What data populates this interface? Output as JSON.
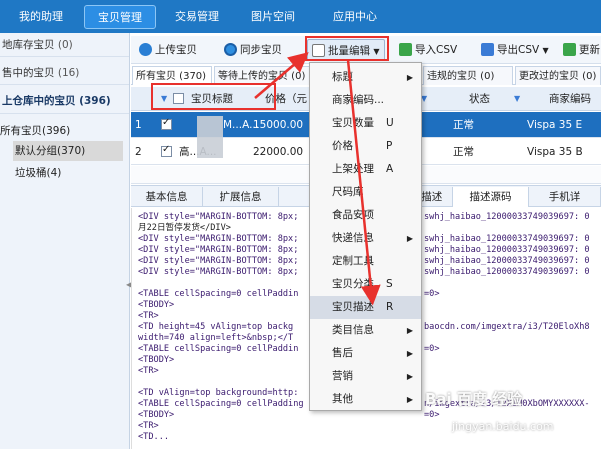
{
  "topnav": {
    "tabs": [
      "我的助理",
      "宝贝管理",
      "交易管理",
      "图片空间",
      "应用中心"
    ],
    "active": "宝贝管理"
  },
  "sidebar": {
    "groups": [
      {
        "label": "地库存宝贝",
        "count": "(0)"
      },
      {
        "label": "售中的宝贝",
        "count": "(16)"
      },
      {
        "label": "上仓库中的宝贝",
        "count": "(396)"
      }
    ],
    "tree": {
      "root": "所有宝贝(396)",
      "children": [
        "默认分组(370)",
        "垃圾桶(4)"
      ]
    }
  },
  "toolbar": {
    "upload": "上传宝贝",
    "sync": "同步宝贝",
    "batch": "批量编辑",
    "import": "导入CSV",
    "export": "导出CSV",
    "update": "更新"
  },
  "filtertabs": [
    "所有宝贝 (370)",
    "等待上传的宝贝 (0)",
    "",
    "",
    "违规的宝贝 (0)",
    "更改过的宝贝 (0)"
  ],
  "table": {
    "headers": [
      "宝贝标题",
      "价格（元",
      "状态",
      "商家编码"
    ],
    "rows": [
      {
        "num": "1",
        "title": "M...A...",
        "price": "15000.00",
        "status": "正常",
        "code": "Vispa 35 E"
      },
      {
        "num": "2",
        "title": "高...A...",
        "price": "22000.00",
        "status": "正常",
        "code": "Vispa 35 B"
      }
    ]
  },
  "bottabs": [
    "基本信息",
    "扩展信息",
    "",
    "",
    "贝描述",
    "描述源码",
    "手机详"
  ],
  "code": {
    "lines": [
      "<DIV style=\"MARGIN-BOTTOM: 8px;",
      "月22日暂停发货</DIV>",
      "<DIV style=\"MARGIN-BOTTOM: 8px;",
      "<DIV style=\"MARGIN-BOTTOM: 8px;",
      "<DIV style=\"MARGIN-BOTTOM: 8px;",
      "<DIV style=\"MARGIN-BOTTOM: 8px;",
      "<TABLE cellSpacing=0 cellPaddin",
      "<TBODY>",
      "<TR>",
      "<TD height=45 vAlign=top backg",
      "width=740 align=left>&nbsp;</T",
      "<TABLE cellSpacing=0 cellPaddin",
      "<TBODY>",
      "<TR>",
      "<TD vAlign=top background=http:",
      "<TABLE cellSpacing=0 cellPadding",
      "<TBODY>",
      "<TR>",
      "<TD..."
    ],
    "right_lines": [
      "swhj_haibao_12000033749039697: 0",
      "swhj_haibao_12000033749039697: 0",
      "swhj_haibao_12000033749039697: 0",
      "swhj_haibao_12000033749039697: 0",
      "swhj_haibao_12000033749039697: 0",
      "=0>",
      "baocdn.com/imgextra/i3/T20EloXh8",
      "=0>",
      "n/imgextra/i3/T2XIM0XbOMYXXXXXX-",
      "=0>"
    ]
  },
  "menu": {
    "items": [
      {
        "label": "标题",
        "shortcut": "",
        "submenu": true
      },
      {
        "label": "商家编码...",
        "shortcut": "",
        "submenu": false
      },
      {
        "label": "宝贝数量",
        "shortcut": "U",
        "submenu": false
      },
      {
        "label": "价格",
        "shortcut": "P",
        "submenu": false
      },
      {
        "label": "上架处理",
        "shortcut": "A",
        "submenu": false
      },
      {
        "label": "尺码库",
        "shortcut": "",
        "submenu": false
      },
      {
        "label": "食品安项",
        "shortcut": "",
        "submenu": false
      },
      {
        "label": "快递信息",
        "shortcut": "",
        "submenu": true
      },
      {
        "label": "定制工具",
        "shortcut": "",
        "submenu": false
      },
      {
        "label": "宝贝分类",
        "shortcut": "S",
        "submenu": false
      },
      {
        "label": "宝贝描述",
        "shortcut": "R",
        "submenu": false
      },
      {
        "label": "类目信息",
        "shortcut": "",
        "submenu": true
      },
      {
        "label": "售后",
        "shortcut": "",
        "submenu": true
      },
      {
        "label": "营销",
        "shortcut": "",
        "submenu": true
      },
      {
        "label": "其他",
        "shortcut": "",
        "submenu": true
      }
    ],
    "highlighted": "宝贝描述"
  },
  "watermark": "Bai 百度 经验",
  "watermark_sub": "jingyan.baidu.com",
  "colors": {
    "nav": "#1f78c5",
    "selected_row": "#1e6fbf",
    "annotation": "#e8312d"
  }
}
